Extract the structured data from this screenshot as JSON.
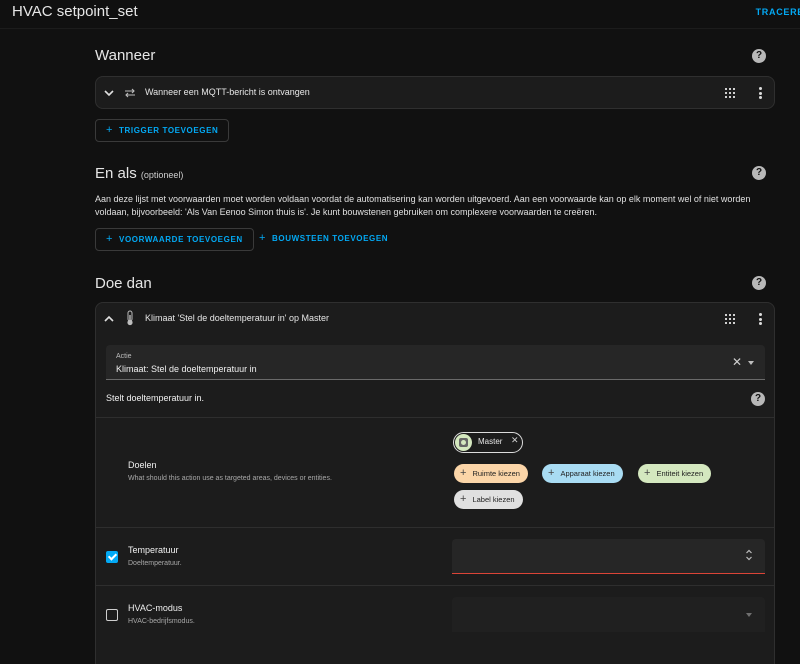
{
  "app": {
    "title": "HVAC setpoint_set",
    "trace_label": "TRACERE"
  },
  "when": {
    "title": "Wanneer",
    "trigger_label": "Wanneer een MQTT-bericht is ontvangen",
    "add_trigger": "TRIGGER TOEVOEGEN"
  },
  "and_if": {
    "title": "En als",
    "optional": "(optioneel)",
    "description": "Aan deze lijst met voorwaarden moet worden voldaan voordat de automatisering kan worden uitgevoerd. Aan een voorwaarde kan op elk moment wel of niet worden voldaan, bijvoorbeeld: 'Als Van Eenoo Simon thuis is'. Je kunt bouwstenen gebruiken om complexere voorwaarden te creëren.",
    "add_condition": "VOORWAARDE TOEVOEGEN",
    "add_building_block": "BOUWSTEEN TOEVOEGEN"
  },
  "then_do": {
    "title": "Doe dan",
    "action_header": "Klimaat 'Stel de doeltemperatuur in' op Master",
    "action_field": {
      "label": "Actie",
      "value": "Klimaat: Stel de doeltemperatuur in"
    },
    "action_description": "Stelt doeltemperatuur in.",
    "targets": {
      "title": "Doelen",
      "subtitle": "What should this action use as targeted areas, devices or entities.",
      "selected_chip": "Master",
      "add_chips": [
        {
          "label": "Ruimte kiezen",
          "color": "#fbd5a8"
        },
        {
          "label": "Apparaat kiezen",
          "color": "#a9dcf3"
        },
        {
          "label": "Entiteit kiezen",
          "color": "#d4e8bf"
        },
        {
          "label": "Label kiezen",
          "color": "#e0e0e0"
        }
      ]
    },
    "temperature": {
      "title": "Temperatuur",
      "subtitle": "Doeltemperatuur.",
      "checked": true,
      "value": ""
    },
    "hvac_mode": {
      "title": "HVAC-modus",
      "subtitle": "HVAC-bedrijfsmodus.",
      "checked": false,
      "value": ""
    }
  },
  "icons": {
    "collapse": "chevron-down-icon",
    "expand": "chevron-up-icon",
    "trigger": "swap-arrows-icon",
    "action": "thermometer-icon",
    "drag": "drag-grid-icon",
    "menu": "more-vertical-icon",
    "help": "help-circle-icon"
  },
  "colors": {
    "accent": "#03a9f4",
    "error_underline": "#db4437"
  }
}
